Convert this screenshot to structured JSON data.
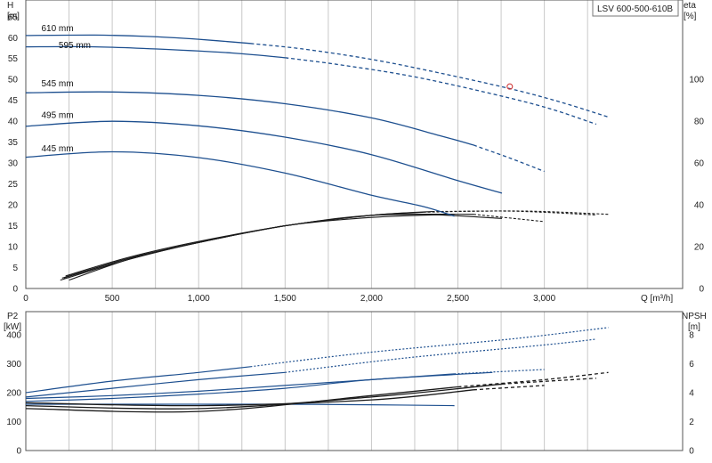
{
  "chart_data": [
    {
      "type": "line",
      "title": "",
      "model_badge": "LSV 600-500-610B",
      "xlabel": "Q [m³/h]",
      "ylabel_left": [
        "H",
        "[m]"
      ],
      "ylabel_right": [
        "eta",
        "[%]"
      ],
      "xlim": [
        0,
        3800
      ],
      "ylim": [
        0,
        69
      ],
      "y2lim": [
        0,
        138
      ],
      "x_ticks": [
        0,
        500,
        1000,
        1500,
        2000,
        2500,
        3000
      ],
      "x_tick_labels": [
        "0",
        "500",
        "1,000",
        "1,500",
        "2,000",
        "2,500",
        "3,000"
      ],
      "y_ticks": [
        0,
        5,
        10,
        15,
        20,
        25,
        30,
        35,
        40,
        45,
        50,
        55,
        60,
        65
      ],
      "y2_ticks": [
        0,
        20,
        40,
        60,
        80,
        100
      ],
      "grid": true,
      "head_series": [
        {
          "name": "610 mm",
          "label_at": [
            90,
            61.5
          ],
          "solid": [
            [
              0,
              60.5
            ],
            [
              400,
              60.6
            ],
            [
              700,
              60.3
            ],
            [
              1000,
              59.6
            ],
            [
              1300,
              58.6
            ]
          ],
          "dashed": [
            [
              1300,
              58.6
            ],
            [
              1600,
              57.3
            ],
            [
              2000,
              54.8
            ],
            [
              2400,
              51.5
            ],
            [
              2800,
              47.8
            ],
            [
              3100,
              44.5
            ],
            [
              3370,
              41.0
            ]
          ]
        },
        {
          "name": "595 mm",
          "label_at": [
            190,
            57.5
          ],
          "solid": [
            [
              0,
              57.8
            ],
            [
              400,
              57.8
            ],
            [
              800,
              57.2
            ],
            [
              1200,
              56.3
            ],
            [
              1500,
              55.2
            ]
          ],
          "dashed": [
            [
              1500,
              55.2
            ],
            [
              1800,
              53.6
            ],
            [
              2200,
              51.0
            ],
            [
              2600,
              47.5
            ],
            [
              3000,
              43.4
            ],
            [
              3300,
              39.3
            ]
          ]
        },
        {
          "name": "545 mm",
          "label_at": [
            90,
            48.3
          ],
          "solid": [
            [
              0,
              46.8
            ],
            [
              500,
              47.0
            ],
            [
              1000,
              46.2
            ],
            [
              1500,
              44.2
            ],
            [
              2000,
              40.8
            ],
            [
              2400,
              36.5
            ],
            [
              2590,
              34.3
            ]
          ],
          "dashed": [
            [
              2590,
              34.3
            ],
            [
              2800,
              31.2
            ],
            [
              3000,
              28.0
            ]
          ]
        },
        {
          "name": "495 mm",
          "label_at": [
            90,
            40.8
          ],
          "solid": [
            [
              0,
              38.8
            ],
            [
              500,
              40.0
            ],
            [
              1000,
              38.9
            ],
            [
              1500,
              36.2
            ],
            [
              2000,
              32.0
            ],
            [
              2500,
              25.8
            ],
            [
              2755,
              22.8
            ]
          ],
          "dashed": []
        },
        {
          "name": "445 mm",
          "label_at": [
            90,
            32.8
          ],
          "solid": [
            [
              0,
              31.4
            ],
            [
              500,
              32.7
            ],
            [
              1000,
              31.3
            ],
            [
              1500,
              27.6
            ],
            [
              2000,
              22.3
            ],
            [
              2300,
              19.6
            ],
            [
              2480,
              17.3
            ]
          ],
          "dashed": []
        }
      ],
      "eta_series": [
        {
          "points": [
            [
              250,
              4
            ],
            [
              600,
              14
            ],
            [
              1000,
              22
            ],
            [
              1500,
              30
            ],
            [
              2000,
              34
            ],
            [
              2480,
              35.5
            ]
          ],
          "dashed": []
        },
        {
          "points": [
            [
              200,
              4
            ],
            [
              600,
              14
            ],
            [
              1000,
              22
            ],
            [
              1500,
              30
            ],
            [
              2000,
              35
            ],
            [
              2300,
              35.5
            ],
            [
              2755,
              33.5
            ]
          ],
          "dashed": []
        },
        {
          "points": [
            [
              230,
              6
            ],
            [
              600,
              15
            ],
            [
              1000,
              22.5
            ],
            [
              1500,
              30
            ],
            [
              2000,
              35
            ],
            [
              2590,
              35.5
            ]
          ],
          "dashed": [
            [
              2590,
              35.5
            ],
            [
              3000,
              32
            ]
          ]
        },
        {
          "points": [
            [
              210,
              5
            ],
            [
              600,
              14.5
            ],
            [
              1000,
              22
            ],
            [
              1500,
              30
            ],
            [
              2000,
              35
            ],
            [
              2300,
              36.5
            ]
          ],
          "dashed": [
            [
              2300,
              36.5
            ],
            [
              2800,
              37.0
            ],
            [
              3300,
              35.2
            ]
          ]
        },
        {
          "points": [
            [
              220,
              5
            ],
            [
              600,
              14.5
            ],
            [
              1000,
              22
            ],
            [
              1500,
              30
            ],
            [
              2000,
              35
            ],
            [
              2350,
              36.8
            ]
          ],
          "dashed": [
            [
              2350,
              36.8
            ],
            [
              2900,
              37.0
            ],
            [
              3370,
              35.5
            ]
          ]
        }
      ],
      "marker": {
        "x": 2800,
        "y": 48.3,
        "color": "#d23a3a"
      },
      "colors": {
        "head": "#1d4f8f",
        "eta": "#1a1a1a",
        "grid": "#c8c8c8"
      }
    },
    {
      "type": "line",
      "title": "",
      "xlabel": "",
      "ylabel_left": [
        "P2",
        "[kW]"
      ],
      "ylabel_right": [
        "NPSH",
        "[m]"
      ],
      "xlim": [
        0,
        3800
      ],
      "ylim": [
        0,
        480
      ],
      "y2lim": [
        0,
        9.6
      ],
      "y_ticks": [
        0,
        100,
        200,
        300,
        400
      ],
      "y2_ticks": [
        0,
        2,
        4,
        6,
        8
      ],
      "grid": true,
      "power_series": [
        {
          "solid": [
            [
              0,
              200
            ],
            [
              500,
              240
            ],
            [
              1000,
              270
            ],
            [
              1300,
              290
            ]
          ],
          "dashed": [
            [
              1300,
              290
            ],
            [
              2000,
              340
            ],
            [
              2800,
              385
            ],
            [
              3370,
              425
            ]
          ]
        },
        {
          "solid": [
            [
              0,
              185
            ],
            [
              500,
              215
            ],
            [
              1000,
              245
            ],
            [
              1500,
              270
            ]
          ],
          "dashed": [
            [
              1500,
              270
            ],
            [
              2200,
              320
            ],
            [
              3000,
              365
            ],
            [
              3300,
              385
            ]
          ]
        },
        {
          "solid": [
            [
              0,
              180
            ],
            [
              500,
              190
            ],
            [
              1000,
              205
            ],
            [
              1500,
              225
            ],
            [
              2000,
              245
            ],
            [
              2480,
              265
            ]
          ],
          "dashed": [
            [
              2480,
              265
            ],
            [
              3000,
              280
            ]
          ]
        },
        {
          "solid": [
            [
              0,
              170
            ],
            [
              500,
              180
            ],
            [
              1000,
              195
            ],
            [
              1500,
              215
            ],
            [
              2000,
              245
            ],
            [
              2700,
              270
            ]
          ],
          "dashed": []
        },
        {
          "solid": [
            [
              0,
              160
            ],
            [
              500,
              160
            ],
            [
              1000,
              160
            ],
            [
              1500,
              160
            ],
            [
              2000,
              158
            ],
            [
              2480,
              155
            ]
          ],
          "dashed": []
        }
      ],
      "npsh_series": [
        {
          "solid": [
            [
              0,
              2.9
            ],
            [
              1000,
              2.7
            ],
            [
              2000,
              3.8
            ],
            [
              2500,
              4.4
            ]
          ],
          "dashed": [
            [
              2500,
              4.4
            ],
            [
              3000,
              4.9
            ],
            [
              3370,
              5.4
            ]
          ]
        },
        {
          "solid": [
            [
              0,
              3.1
            ],
            [
              1000,
              2.9
            ],
            [
              2000,
              3.7
            ],
            [
              2755,
              4.6
            ]
          ],
          "dashed": [
            [
              2755,
              4.6
            ],
            [
              3300,
              5.0
            ]
          ]
        },
        {
          "solid": [
            [
              0,
              3.3
            ],
            [
              1000,
              3.1
            ],
            [
              2000,
              3.5
            ],
            [
              2590,
              4.2
            ]
          ],
          "dashed": [
            [
              2590,
              4.2
            ],
            [
              3000,
              4.5
            ]
          ]
        }
      ],
      "colors": {
        "power": "#1d4f8f",
        "npsh": "#1a1a1a"
      }
    }
  ]
}
